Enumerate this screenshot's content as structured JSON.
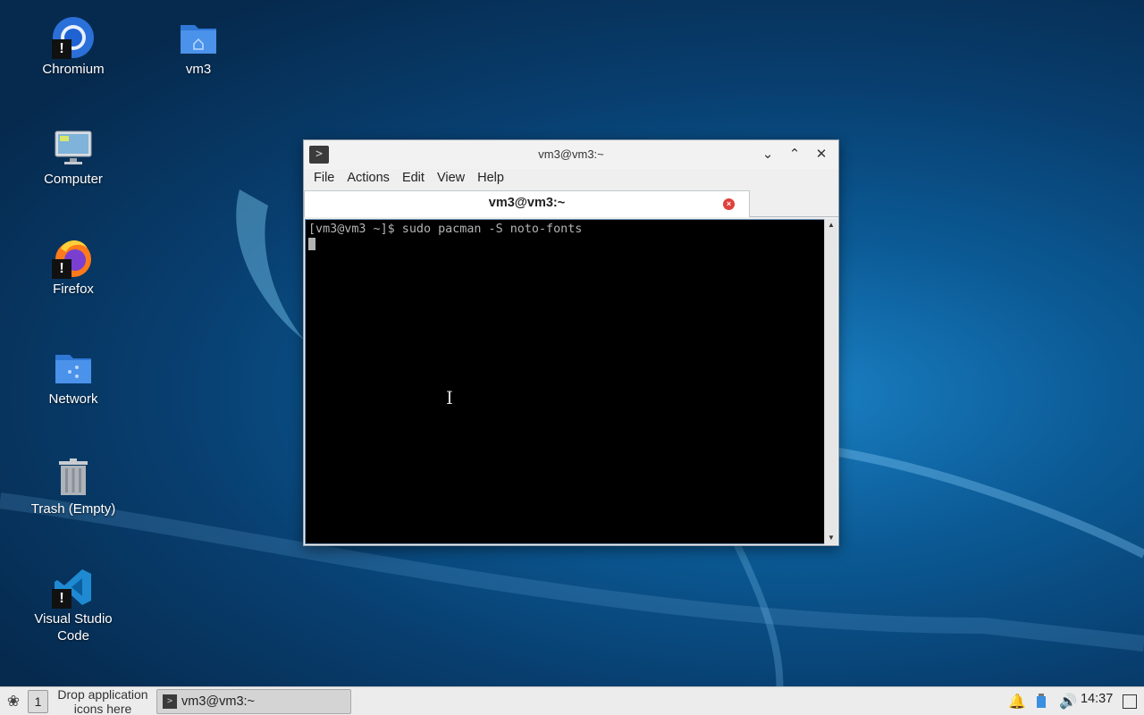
{
  "desktop": {
    "icons": [
      {
        "label": "Chromium",
        "icon": "chromium-icon"
      },
      {
        "label": "vm3",
        "icon": "home-folder-icon"
      },
      {
        "label": "Computer",
        "icon": "computer-icon"
      },
      {
        "label": "Firefox",
        "icon": "firefox-icon"
      },
      {
        "label": "Network",
        "icon": "network-folder-icon"
      },
      {
        "label": "Trash (Empty)",
        "icon": "trash-icon"
      },
      {
        "label": "Visual Studio Code",
        "icon": "vscode-icon"
      }
    ],
    "warning_badge": "!"
  },
  "window": {
    "title": "vm3@vm3:~",
    "menu": [
      "File",
      "Actions",
      "Edit",
      "View",
      "Help"
    ],
    "tab_label": "vm3@vm3:~",
    "terminal_line": "[vm3@vm3 ~]$ sudo pacman -S noto-fonts"
  },
  "taskbar": {
    "workspace": "1",
    "drop_hint_line1": "Drop application",
    "drop_hint_line2": "icons here",
    "task_label": "vm3@vm3:~",
    "clock": "14:37"
  },
  "colors": {
    "desktop_bg": "#0b5a95",
    "terminal_bg": "#000000",
    "terminal_fg": "#b3b3b3",
    "tab_close": "#e0413a"
  }
}
